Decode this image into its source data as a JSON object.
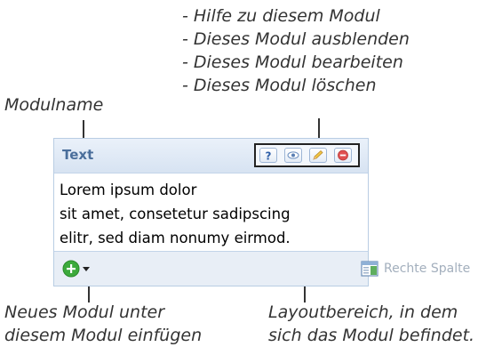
{
  "callouts": {
    "actions": [
      "- Hilfe zu diesem Modul",
      "- Dieses Modul ausblenden",
      "- Dieses Modul bearbeiten",
      "- Dieses Modul löschen"
    ],
    "module_name": "Modulname",
    "add_module": [
      "Neues Modul unter",
      "diesem Modul einfügen"
    ],
    "layout_area": [
      "Layoutbereich, in dem",
      "sich das Modul befindet."
    ]
  },
  "module": {
    "name": "Text",
    "content": [
      "Lorem ipsum dolor",
      "sit amet, consetetur sadipscing",
      "elitr, sed diam nonumy eirmod."
    ],
    "layout_area_label": "Rechte Spalte",
    "icons": [
      "help-icon",
      "eye-icon",
      "pencil-icon",
      "delete-icon"
    ]
  },
  "colors": {
    "header_bg": "#d7e3f2",
    "title_color": "#4a6e9b",
    "add_green": "#3caa3c",
    "delete_red": "#e05050"
  }
}
